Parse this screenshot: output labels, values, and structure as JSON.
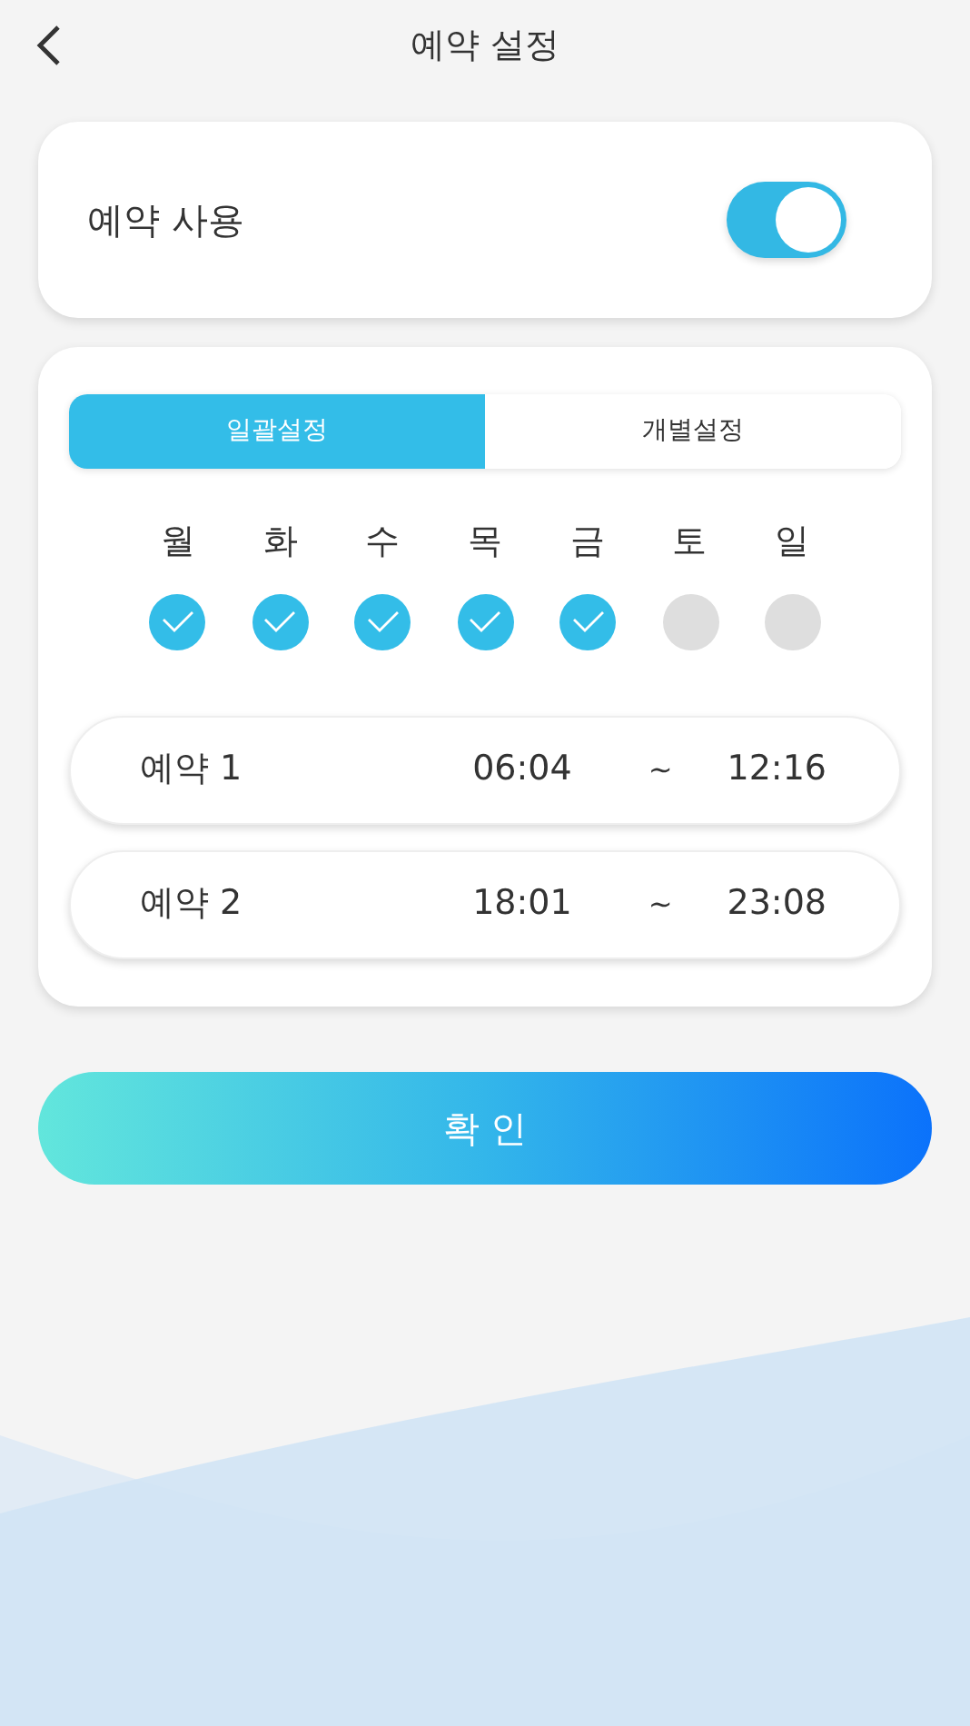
{
  "header": {
    "title": "예약 설정"
  },
  "reservation": {
    "label": "예약 사용",
    "on": true
  },
  "tabs": [
    {
      "label": "일괄설정",
      "selected": true
    },
    {
      "label": "개별설정",
      "selected": false
    }
  ],
  "days": [
    {
      "label": "월",
      "checked": true
    },
    {
      "label": "화",
      "checked": true
    },
    {
      "label": "수",
      "checked": true
    },
    {
      "label": "목",
      "checked": true
    },
    {
      "label": "금",
      "checked": true
    },
    {
      "label": "토",
      "checked": false
    },
    {
      "label": "일",
      "checked": false
    }
  ],
  "schedules": [
    {
      "name": "예약 1",
      "start": "06:04",
      "separator": "~",
      "end": "12:16"
    },
    {
      "name": "예약 2",
      "start": "18:01",
      "separator": "~",
      "end": "23:08"
    }
  ],
  "confirm_button": "확 인"
}
